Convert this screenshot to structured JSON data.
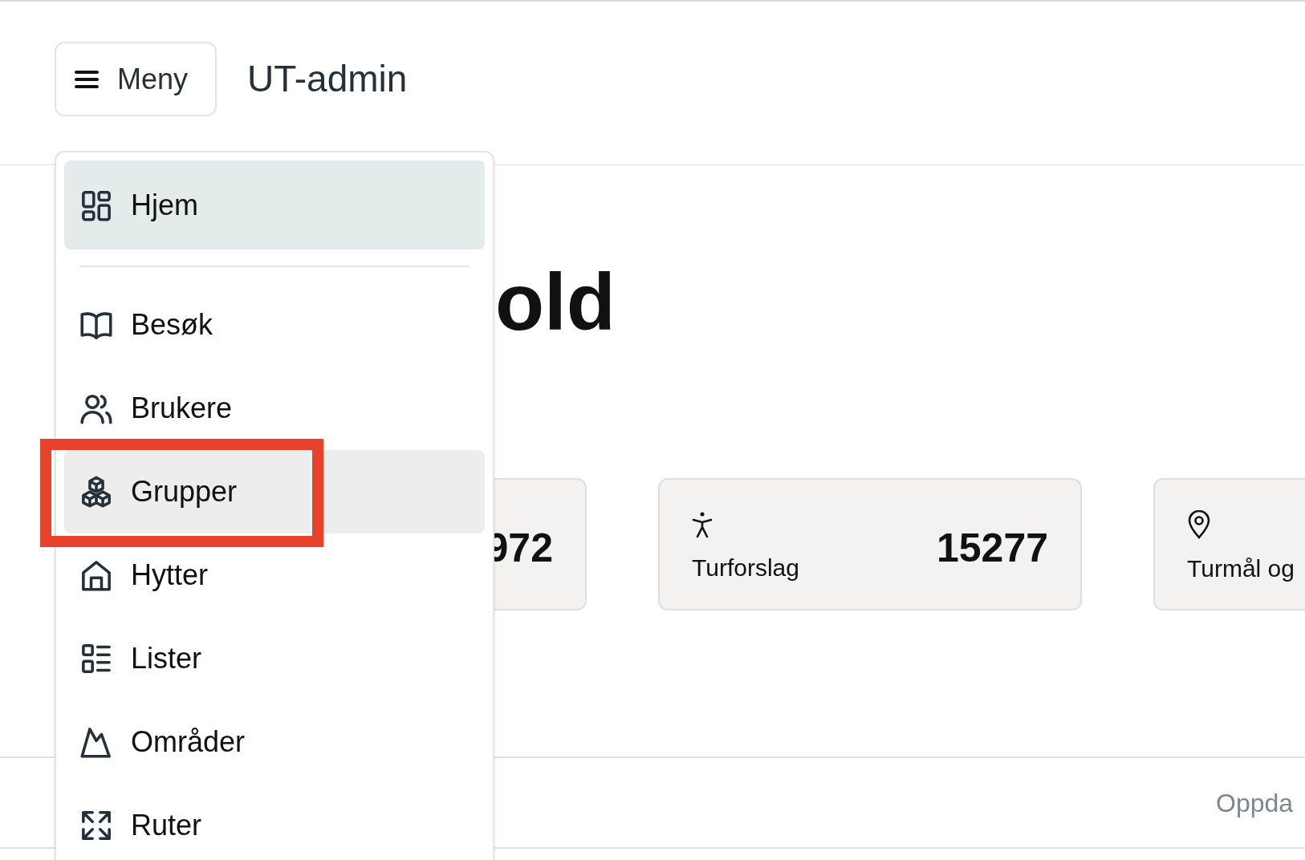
{
  "header": {
    "menu_button": "Meny",
    "title": "UT-admin"
  },
  "menu": {
    "items": [
      {
        "label": "Hjem",
        "selected": true,
        "hovered": false,
        "highlighted": false
      },
      {
        "label": "Besøk",
        "selected": false,
        "hovered": false,
        "highlighted": false
      },
      {
        "label": "Brukere",
        "selected": false,
        "hovered": false,
        "highlighted": false
      },
      {
        "label": "Grupper",
        "selected": false,
        "hovered": true,
        "highlighted": true
      },
      {
        "label": "Hytter",
        "selected": false,
        "hovered": false,
        "highlighted": false
      },
      {
        "label": "Lister",
        "selected": false,
        "hovered": false,
        "highlighted": false
      },
      {
        "label": "Områder",
        "selected": false,
        "hovered": false,
        "highlighted": false
      },
      {
        "label": "Ruter",
        "selected": false,
        "hovered": false,
        "highlighted": false
      }
    ]
  },
  "page": {
    "heading": "old",
    "stats": [
      {
        "value": "972"
      },
      {
        "label": "Turforslag",
        "value": "15277"
      },
      {
        "label": "Turmål og"
      }
    ],
    "footer_text": "Oppda"
  }
}
